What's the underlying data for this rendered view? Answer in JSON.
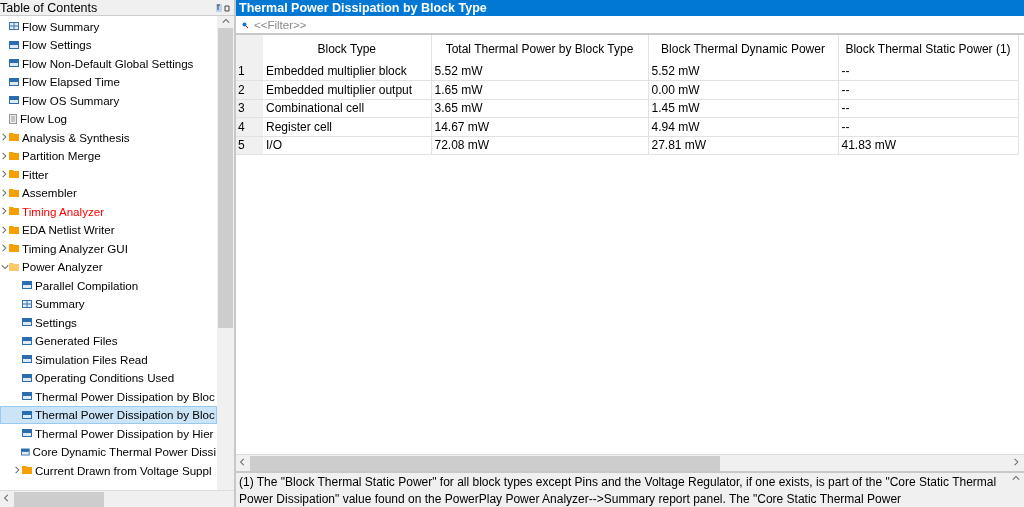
{
  "toc": {
    "title": "Table of Contents",
    "items": [
      {
        "label": "Flow Summary",
        "kind": "grid",
        "warning": false
      },
      {
        "label": "Flow Settings",
        "kind": "table",
        "warning": false
      },
      {
        "label": "Flow Non-Default Global Settings",
        "kind": "table",
        "warning": false
      },
      {
        "label": "Flow Elapsed Time",
        "kind": "table",
        "warning": false
      },
      {
        "label": "Flow OS Summary",
        "kind": "table",
        "warning": false
      },
      {
        "label": "Flow Log",
        "kind": "log",
        "warning": false
      },
      {
        "label": "Analysis & Synthesis",
        "kind": "folder",
        "expanded": false,
        "warning": false
      },
      {
        "label": "Partition Merge",
        "kind": "folder",
        "expanded": false,
        "warning": false
      },
      {
        "label": "Fitter",
        "kind": "folder",
        "expanded": false,
        "warning": false
      },
      {
        "label": "Assembler",
        "kind": "folder",
        "expanded": false,
        "warning": false
      },
      {
        "label": "Timing Analyzer",
        "kind": "folder",
        "expanded": false,
        "warning": true
      },
      {
        "label": "EDA Netlist Writer",
        "kind": "folder",
        "expanded": false,
        "warning": false
      },
      {
        "label": "Timing Analyzer GUI",
        "kind": "folder",
        "expanded": false,
        "warning": false
      },
      {
        "label": "Power Analyzer",
        "kind": "folder",
        "expanded": true,
        "warning": false,
        "children": [
          {
            "label": "Parallel Compilation",
            "kind": "table",
            "selected": false
          },
          {
            "label": "Summary",
            "kind": "grid",
            "selected": false
          },
          {
            "label": "Settings",
            "kind": "table",
            "selected": false
          },
          {
            "label": "Generated Files",
            "kind": "table",
            "selected": false
          },
          {
            "label": "Simulation Files Read",
            "kind": "table",
            "selected": false
          },
          {
            "label": "Operating Conditions Used",
            "kind": "table",
            "selected": false
          },
          {
            "label": "Thermal Power Dissipation by Bloc",
            "kind": "table",
            "selected": false
          },
          {
            "label": "Thermal Power Dissipation by Bloc",
            "kind": "table",
            "selected": true
          },
          {
            "label": "Thermal Power Dissipation by Hier",
            "kind": "table",
            "selected": false
          },
          {
            "label": "Core Dynamic Thermal Power Dissi",
            "kind": "table",
            "selected": false
          },
          {
            "label": "Current Drawn from Voltage Suppl",
            "kind": "folder",
            "expanded": false,
            "selected": false
          }
        ]
      }
    ]
  },
  "report": {
    "title": "Thermal Power Dissipation by Block Type",
    "filter": {
      "placeholder": "<<Filter>>"
    },
    "table": {
      "columns": [
        "Block Type",
        "Total Thermal Power by Block Type",
        "Block Thermal Dynamic Power",
        "Block Thermal Static Power (1)"
      ],
      "rows": [
        {
          "index": "1",
          "cells": [
            "Embedded multiplier block",
            "5.52 mW",
            "5.52 mW",
            "--"
          ]
        },
        {
          "index": "2",
          "cells": [
            "Embedded multiplier output",
            "1.65 mW",
            "0.00 mW",
            "--"
          ]
        },
        {
          "index": "3",
          "cells": [
            "Combinational cell",
            "3.65 mW",
            "1.45 mW",
            "--"
          ]
        },
        {
          "index": "4",
          "cells": [
            "Register cell",
            "14.67 mW",
            "4.94 mW",
            "--"
          ]
        },
        {
          "index": "5",
          "cells": [
            "I/O",
            "72.08 mW",
            "27.81 mW",
            "41.83 mW"
          ]
        }
      ]
    },
    "footnote": "(1) The \"Block Thermal Static Power\" for all block types except Pins and the Voltage Regulator, if one exists, is part of the \"Core Static Thermal Power Dissipation\" value found on the PowerPlay Power Analyzer-->Summary report panel. The \"Core Static Thermal Power"
  }
}
